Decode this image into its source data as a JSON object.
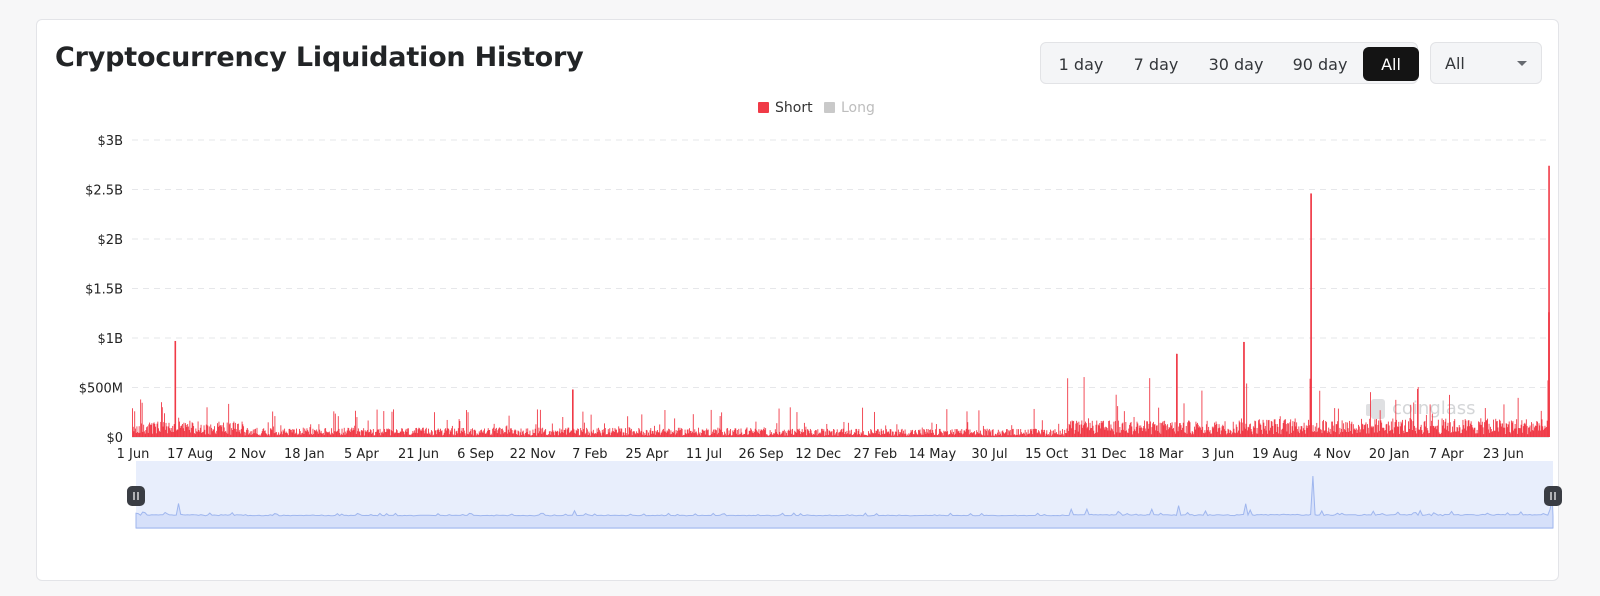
{
  "header": {
    "title": "Cryptocurrency Liquidation History"
  },
  "range_buttons": [
    {
      "label": "1 day",
      "active": false
    },
    {
      "label": "7 day",
      "active": false
    },
    {
      "label": "30 day",
      "active": false
    },
    {
      "label": "90 day",
      "active": false
    },
    {
      "label": "All",
      "active": true
    }
  ],
  "coin_select": {
    "value": "All"
  },
  "watermark": "coinglass",
  "colors": {
    "short": "#f03a47",
    "long": "#c9c9c9",
    "grid": "#e6e7ea",
    "navigator_fill": "#e8eefc",
    "navigator_line": "#9fb6ee"
  },
  "chart_data": {
    "type": "bar",
    "title": "Cryptocurrency Liquidation History",
    "legend": [
      {
        "name": "Short",
        "color": "#f03a47",
        "visible": true
      },
      {
        "name": "Long",
        "color": "#c9c9c9",
        "visible": false
      }
    ],
    "legend_placement": "top-center",
    "y_ticks": [
      {
        "value": 0,
        "label": "$0"
      },
      {
        "value": 500000000,
        "label": "$500M"
      },
      {
        "value": 1000000000,
        "label": "$1B"
      },
      {
        "value": 1500000000,
        "label": "$1.5B"
      },
      {
        "value": 2000000000,
        "label": "$2B"
      },
      {
        "value": 2500000000,
        "label": "$2.5B"
      },
      {
        "value": 3000000000,
        "label": "$3B"
      }
    ],
    "ylim": [
      0,
      3000000000
    ],
    "x_tick_labels": [
      "1 Jun",
      "17 Aug",
      "2 Nov",
      "18 Jan",
      "5 Apr",
      "21 Jun",
      "6 Sep",
      "22 Nov",
      "7 Feb",
      "25 Apr",
      "11 Jul",
      "26 Sep",
      "12 Dec",
      "27 Feb",
      "14 May",
      "30 Jul",
      "15 Oct",
      "31 Dec",
      "18 Mar",
      "3 Jun",
      "19 Aug",
      "4 Nov",
      "20 Jan",
      "7 Apr",
      "23 Jun"
    ],
    "x_tick_spacing_days": 77,
    "grid": true,
    "series": [
      {
        "name": "Short",
        "visible": true,
        "days_total": 1900,
        "baseline_by_segment": [
          {
            "start_day": 0,
            "end_day": 150,
            "typical": 150000000,
            "peak": 400000000
          },
          {
            "start_day": 150,
            "end_day": 850,
            "typical": 90000000,
            "peak": 280000000
          },
          {
            "start_day": 850,
            "end_day": 1250,
            "typical": 80000000,
            "peak": 300000000
          },
          {
            "start_day": 1250,
            "end_day": 1480,
            "typical": 160000000,
            "peak": 650000000
          },
          {
            "start_day": 1480,
            "end_day": 1900,
            "typical": 180000000,
            "peak": 600000000
          }
        ],
        "spikes": [
          {
            "day": 57,
            "value": 970000000
          },
          {
            "day": 590,
            "value": 480000000
          },
          {
            "day": 1400,
            "value": 840000000
          },
          {
            "day": 1490,
            "value": 960000000
          },
          {
            "day": 1580,
            "value": 2460000000
          },
          {
            "day": 1900,
            "value": 2740000000
          },
          {
            "day": 1902,
            "value": 1260000000
          }
        ]
      }
    ]
  }
}
